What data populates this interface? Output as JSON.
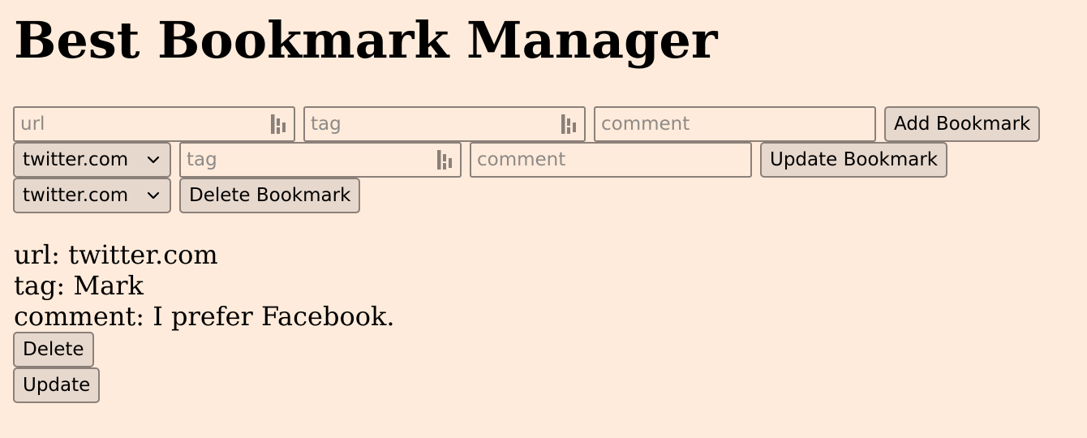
{
  "page": {
    "title": "Best Bookmark Manager"
  },
  "add_form": {
    "url_placeholder": "url",
    "tag_placeholder": "tag",
    "comment_placeholder": "comment",
    "submit_label": "Add Bookmark"
  },
  "update_form": {
    "selected_url": "twitter.com",
    "tag_placeholder": "tag",
    "comment_placeholder": "comment",
    "submit_label": "Update Bookmark"
  },
  "delete_form": {
    "selected_url": "twitter.com",
    "submit_label": "Delete Bookmark"
  },
  "bookmark": {
    "url_line": "url: twitter.com",
    "tag_line": "tag: Mark",
    "comment_line": "comment: I prefer Facebook.",
    "delete_label": "Delete",
    "update_label": "Update"
  },
  "icons": {
    "password_manager": "password-manager-icon",
    "dropdown": "chevron-down-icon"
  },
  "colors": {
    "background": "#ffebdb",
    "button_bg": "#e7d8cd",
    "border": "#8b8079",
    "placeholder": "#8e8a87"
  }
}
